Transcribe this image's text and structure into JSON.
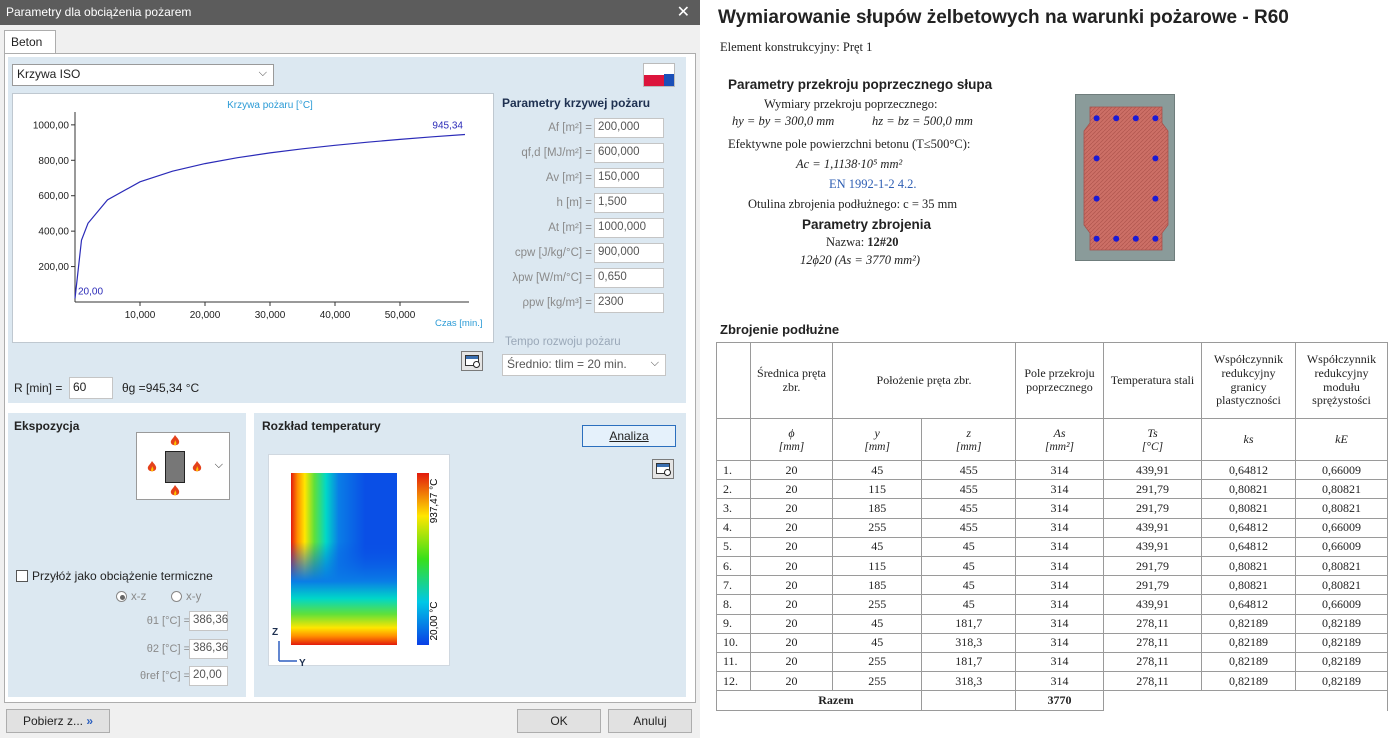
{
  "dialog": {
    "title": "Parametry dla obciążenia pożarem",
    "close_glyph": "✕",
    "tab": "Beton",
    "curve_type": "Krzywa ISO",
    "chart_data": {
      "type": "line",
      "title": "Krzywa pożaru [°C]",
      "xlabel": "Czas [min.]",
      "ylabel": "",
      "xlim": [
        0,
        60
      ],
      "ylim": [
        0,
        1050
      ],
      "x_ticks": [
        "10,000",
        "20,000",
        "30,000",
        "40,000",
        "50,000"
      ],
      "y_ticks": [
        "200,00",
        "400,00",
        "600,00",
        "800,00",
        "1000,00"
      ],
      "start_label": "20,00",
      "end_label": "945,34",
      "series": [
        {
          "name": "",
          "color": "#2b2bb8",
          "x": [
            0,
            1,
            2,
            5,
            10,
            15,
            20,
            25,
            30,
            35,
            40,
            45,
            50,
            55,
            60
          ],
          "y": [
            20,
            349.2,
            444.5,
            576.4,
            678.4,
            738.6,
            781.4,
            814.6,
            841.8,
            864.8,
            884.7,
            902.3,
            918.0,
            932.3,
            945.3
          ]
        }
      ]
    },
    "params": {
      "heading": "Parametry krzywej pożaru",
      "rows": [
        {
          "label": "Af [m²] =",
          "value": "200,000"
        },
        {
          "label": "qf,d [MJ/m²] =",
          "value": "600,000"
        },
        {
          "label": "Av [m²] =",
          "value": "150,000"
        },
        {
          "label": "h [m] =",
          "value": "1,500"
        },
        {
          "label": "At [m²] =",
          "value": "1000,000"
        },
        {
          "label": "cpw [J/kg/°C] =",
          "value": "900,000"
        },
        {
          "label": "λpw [W/m/°C] =",
          "value": "0,650"
        },
        {
          "label": "ρpw [kg/m³] =",
          "value": "2300"
        }
      ],
      "tempo_label": "Tempo rozwoju pożaru",
      "tempo_value": "Średnio: tlim = 20 min."
    },
    "r_label": "R [min] =",
    "r_value": "60",
    "theta_g": "θg =945,34 °C",
    "exposure": {
      "heading": "Ekspozycja",
      "thermal_checkbox": "Przyłóż jako obciążenie termiczne",
      "plane_xz": "x-z",
      "plane_xy": "x-y",
      "theta1_label": "θ1 [°C] =",
      "theta1_value": "386,36",
      "theta2_label": "θ2 [°C] =",
      "theta2_value": "386,36",
      "thetaref_label": "θref [°C] =",
      "thetaref_value": "20,00"
    },
    "temperature": {
      "heading": "Rozkład temperatury",
      "analiza_button": "Analiza",
      "scale_max": "937,47 °C",
      "scale_min": "20,00 °C",
      "axis_z": "Z",
      "axis_y": "Y"
    },
    "buttons": {
      "pobierz": "Pobierz z...",
      "ok": "OK",
      "anuluj": "Anuluj"
    }
  },
  "report": {
    "title": "Wymiarowanie słupów żelbetowych na warunki pożarowe - R60",
    "element": "Element konstrukcyjny:  Pręt 1",
    "section_heading": "Parametry przekroju poprzecznego słupa",
    "dims_label": "Wymiary przekroju poprzecznego:",
    "dims_hy": "hy = by = 300,0 mm",
    "dims_hz": "hz = bz = 500,0 mm",
    "area_label": "Efektywne pole powierzchni betonu (T≤500°C):",
    "area_formula": "Ac = 1,1138·10⁵ mm²",
    "area_ref": "EN 1992-1-2 4.2.",
    "cover": "Otulina zbrojenia podłużnego:  c = 35 mm",
    "rebar_heading": "Parametry zbrojenia",
    "rebar_name_label": "Nazwa:",
    "rebar_name": "12#20",
    "rebar_formula": "12ϕ20   (As = 3770 mm²)",
    "table_heading": "Zbrojenie podłużne",
    "columns": [
      "",
      "Średnica pręta zbr.",
      "Położenie pręta zbr.",
      "Pole przekroju poprzecznego",
      "Temperatura stali",
      "Współczynnik redukcyjny granicy plastyczności",
      "Współczynnik redukcyjny modułu sprężystości"
    ],
    "subheaders": [
      {
        "sym": "ϕ",
        "unit": "[mm]"
      },
      {
        "sym": "y",
        "unit": "[mm]"
      },
      {
        "sym": "z",
        "unit": "[mm]"
      },
      {
        "sym": "As",
        "unit": "[mm²]"
      },
      {
        "sym": "Ts",
        "unit": "[°C]"
      },
      {
        "sym": "ks",
        "unit": ""
      },
      {
        "sym": "kE",
        "unit": ""
      }
    ],
    "rows": [
      [
        "1.",
        "20",
        "45",
        "455",
        "314",
        "439,91",
        "0,64812",
        "0,66009"
      ],
      [
        "2.",
        "20",
        "115",
        "455",
        "314",
        "291,79",
        "0,80821",
        "0,80821"
      ],
      [
        "3.",
        "20",
        "185",
        "455",
        "314",
        "291,79",
        "0,80821",
        "0,80821"
      ],
      [
        "4.",
        "20",
        "255",
        "455",
        "314",
        "439,91",
        "0,64812",
        "0,66009"
      ],
      [
        "5.",
        "20",
        "45",
        "45",
        "314",
        "439,91",
        "0,64812",
        "0,66009"
      ],
      [
        "6.",
        "20",
        "115",
        "45",
        "314",
        "291,79",
        "0,80821",
        "0,80821"
      ],
      [
        "7.",
        "20",
        "185",
        "45",
        "314",
        "291,79",
        "0,80821",
        "0,80821"
      ],
      [
        "8.",
        "20",
        "255",
        "45",
        "314",
        "439,91",
        "0,64812",
        "0,66009"
      ],
      [
        "9.",
        "20",
        "45",
        "181,7",
        "314",
        "278,11",
        "0,82189",
        "0,82189"
      ],
      [
        "10.",
        "20",
        "45",
        "318,3",
        "314",
        "278,11",
        "0,82189",
        "0,82189"
      ],
      [
        "11.",
        "20",
        "255",
        "181,7",
        "314",
        "278,11",
        "0,82189",
        "0,82189"
      ],
      [
        "12.",
        "20",
        "255",
        "318,3",
        "314",
        "278,11",
        "0,82189",
        "0,82189"
      ]
    ],
    "total_label": "Razem",
    "total_value": "3770"
  }
}
